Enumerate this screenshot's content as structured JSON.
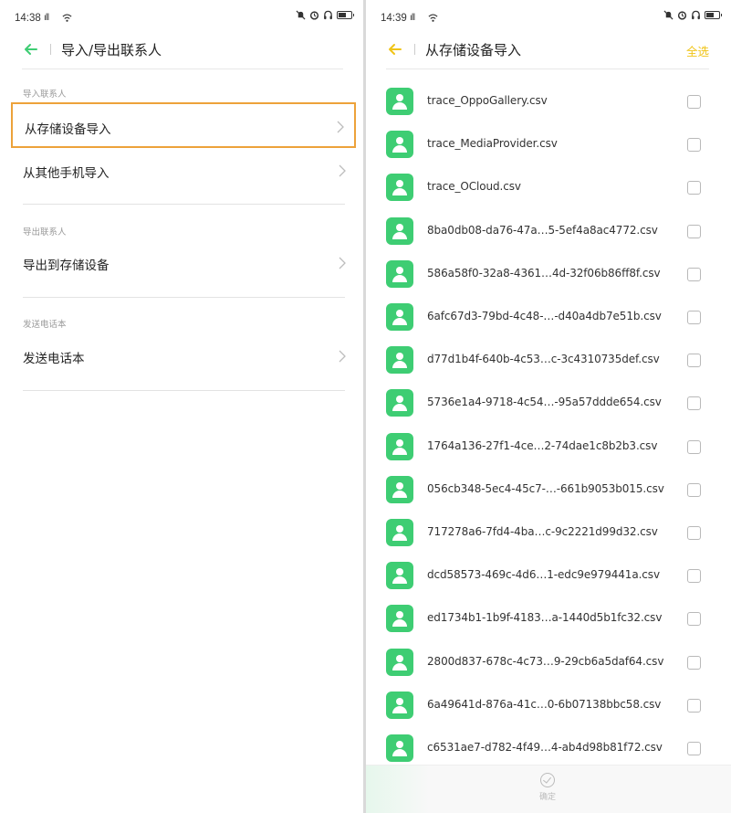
{
  "left": {
    "status": {
      "time": "14:38",
      "signal": "ıll"
    },
    "title": "导入/导出联系人",
    "sections": [
      {
        "label": "导入联系人",
        "items": [
          "从存储设备导入",
          "从其他手机导入"
        ]
      },
      {
        "label": "导出联系人",
        "items": [
          "导出到存储设备"
        ]
      },
      {
        "label": "发送电话本",
        "items": [
          "发送电话本"
        ]
      }
    ]
  },
  "right": {
    "status": {
      "time": "14:39",
      "signal": "ıll"
    },
    "title": "从存储设备导入",
    "select_all": "全选",
    "files": [
      "trace_OppoGallery.csv",
      "trace_MediaProvider.csv",
      "trace_OCloud.csv",
      "8ba0db08-da76-47a…5-5ef4a8ac4772.csv",
      "586a58f0-32a8-4361…4d-32f06b86ff8f.csv",
      "6afc67d3-79bd-4c48-…-d40a4db7e51b.csv",
      "d77d1b4f-640b-4c53…c-3c4310735def.csv",
      "5736e1a4-9718-4c54…-95a57ddde654.csv",
      "1764a136-27f1-4ce…2-74dae1c8b2b3.csv",
      "056cb348-5ec4-45c7-…-661b9053b015.csv",
      "717278a6-7fd4-4ba…c-9c2221d99d32.csv",
      "dcd58573-469c-4d6…1-edc9e979441a.csv",
      "ed1734b1-1b9f-4183…a-1440d5b1fc32.csv",
      "2800d837-678c-4c73…9-29cb6a5daf64.csv",
      "6a49641d-876a-41c…0-6b07138bbc58.csv",
      "c6531ae7-d782-4f49…4-ab4d98b81f72.csv"
    ],
    "confirm": "确定"
  },
  "colors": {
    "accent_green": "#3ecd73",
    "highlight": "#eda23a",
    "select_all": "#f0c418"
  },
  "icons": [
    "back-arrow-icon",
    "chevron-right-icon",
    "contact-file-icon",
    "checkbox",
    "confirm-check-icon",
    "wifi-icon",
    "battery-icon",
    "headset-icon",
    "alarm-icon",
    "mute-icon"
  ]
}
